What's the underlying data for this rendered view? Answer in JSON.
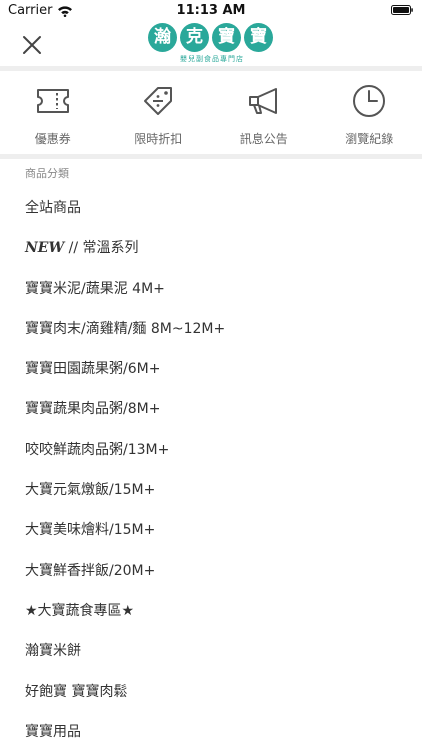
{
  "status_bar": {
    "carrier": "Carrier",
    "time": "11:13 AM"
  },
  "header": {
    "logo_chars": [
      "瀚",
      "克",
      "寶",
      "寶"
    ],
    "logo_subtitle": "嬰兒副食品專門店",
    "accent_color": "#2aa89a"
  },
  "quick_actions": [
    {
      "label": "優惠券",
      "icon": "ticket-icon"
    },
    {
      "label": "限時折扣",
      "icon": "discount-tag-icon"
    },
    {
      "label": "訊息公告",
      "icon": "megaphone-icon"
    },
    {
      "label": "瀏覽紀錄",
      "icon": "clock-icon"
    }
  ],
  "categories": {
    "title": "商品分類",
    "items": [
      {
        "label": "全站商品"
      },
      {
        "tag": "NEW",
        "label": " // 常溫系列"
      },
      {
        "label": "寶寶米泥/蔬果泥 4M+"
      },
      {
        "label": "寶寶肉末/滴雞精/麵 8M~12M+"
      },
      {
        "label": "寶寶田園蔬果粥/6M+"
      },
      {
        "label": "寶寶蔬果肉品粥/8M+"
      },
      {
        "label": "咬咬鮮蔬肉品粥/13M+"
      },
      {
        "label": "大寶元氣燉飯/15M+"
      },
      {
        "label": "大寶美味燴料/15M+"
      },
      {
        "label": "大寶鮮香拌飯/20M+"
      },
      {
        "label": "★大寶蔬食專區★"
      },
      {
        "label": "瀚寶米餅"
      },
      {
        "label": "好飽寶 寶寶肉鬆"
      },
      {
        "label": "寶寶用品"
      }
    ]
  }
}
